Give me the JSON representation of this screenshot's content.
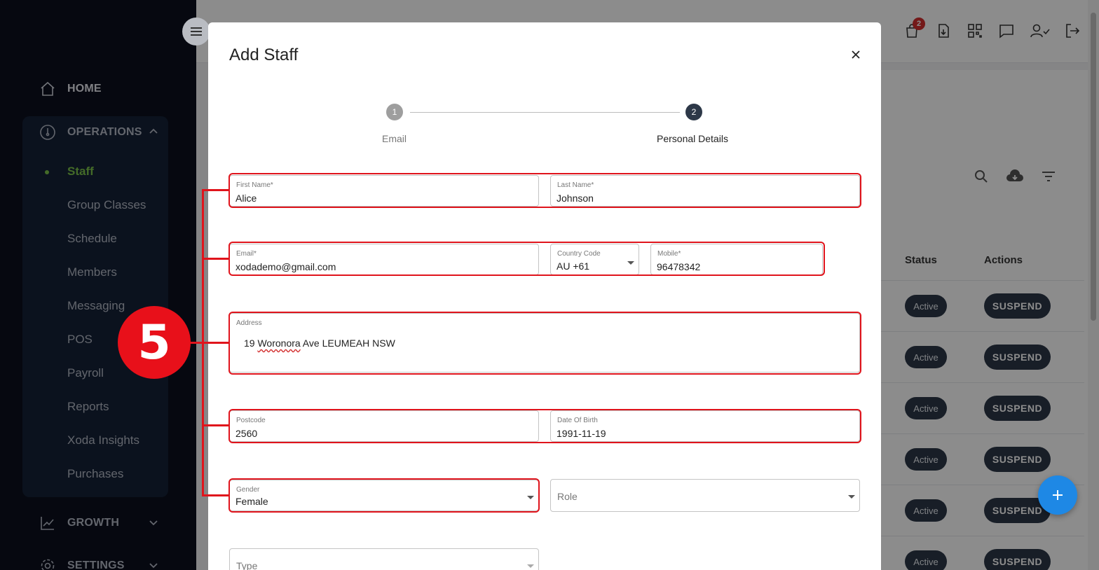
{
  "sidebar": {
    "home": "HOME",
    "operations": "OPERATIONS",
    "operations_items": [
      "Staff",
      "Group Classes",
      "Schedule",
      "Members",
      "Messaging",
      "POS",
      "Payroll",
      "Reports",
      "Xoda Insights",
      "Purchases"
    ],
    "active_item": "Staff",
    "growth": "GROWTH",
    "settings": "SETTINGS"
  },
  "topbar": {
    "cart_badge": "2",
    "icons": [
      "cart-icon",
      "download-icon",
      "qr-code-icon",
      "chat-icon",
      "user-check-icon",
      "logout-icon"
    ]
  },
  "table": {
    "headers": {
      "status": "Status",
      "actions": "Actions"
    },
    "rows": [
      {
        "status": "Active",
        "action": "SUSPEND"
      },
      {
        "status": "Active",
        "action": "SUSPEND"
      },
      {
        "status": "Active",
        "action": "SUSPEND"
      },
      {
        "status": "Active",
        "action": "SUSPEND"
      },
      {
        "status": "Active",
        "action": "SUSPEND"
      },
      {
        "status": "Active",
        "action": "SUSPEND"
      }
    ]
  },
  "modal": {
    "title": "Add Staff",
    "close": "×",
    "steps": [
      {
        "number": "1",
        "label": "Email"
      },
      {
        "number": "2",
        "label": "Personal Details"
      }
    ],
    "fields": {
      "first_name": {
        "label": "First Name",
        "value": "Alice"
      },
      "last_name": {
        "label": "Last Name",
        "value": "Johnson"
      },
      "email": {
        "label": "Email",
        "value": "xodademo@gmail.com"
      },
      "country_code": {
        "label": "Country Code",
        "value": "AU +61"
      },
      "mobile": {
        "label": "Mobile",
        "value": "96478342"
      },
      "address": {
        "label": "Address",
        "value_prefix": "19 ",
        "value_misspelled": "Woronora",
        "value_suffix": " Ave LEUMEAH NSW"
      },
      "postcode": {
        "label": "Postcode",
        "value": "2560"
      },
      "dob": {
        "label": "Date Of Birth",
        "value": "1991-11-19"
      },
      "gender": {
        "label": "Gender",
        "value": "Female"
      },
      "role": {
        "placeholder": "Role"
      },
      "type": {
        "placeholder": "Type"
      }
    },
    "required_mark": "*"
  },
  "annotation": {
    "step_number": "5"
  },
  "colors": {
    "sidebar_bg": "#0b0f1e",
    "ops_bg": "#152238",
    "accent_green": "#7cc44a",
    "highlight_red": "#e0141c",
    "fab_blue": "#1e88e5"
  }
}
